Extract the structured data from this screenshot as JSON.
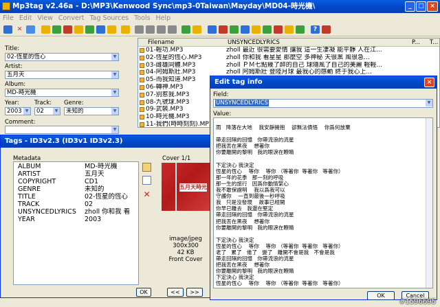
{
  "window": {
    "title": "Mp3tag v2.46a   -   D:\\MP3\\Kenwood Sync\\mp3-0Taiwan\\Mayday\\MD04-時光機\\"
  },
  "menu": [
    "File",
    "Edit",
    "View",
    "Convert",
    "Tag Sources",
    "Tools",
    "Help"
  ],
  "tagpanel": {
    "title_label": "Title:",
    "title_value": "02-恆星的恆心",
    "artist_label": "Artist:",
    "artist_value": "五月天",
    "album_label": "Album:",
    "album_value": "MD-時光機",
    "year_label": "Year:",
    "year_value": "2003",
    "track_label": "Track:",
    "track_value": "02",
    "genre_label": "Genre:",
    "genre_value": "未知的",
    "comment_label": "Comment:"
  },
  "filelist": {
    "col_filename": "Filename",
    "col_lyrics": "UNSYNCEDLYRICS",
    "col_p1": "P...",
    "col_t": "T...",
    "rows": [
      {
        "name": "01-輕功.MP3",
        "lyrics": "zholl  最近 很需要愛情   讓我 這一生凄凝  能平靜  人在江..."
      },
      {
        "name": "02-恆星的恆心.MP3",
        "lyrics": "zholl  你和我   看星星   那麼空    多神秘  天很黑   風很急..."
      },
      {
        "name": "03-雌雄同體.MP3",
        "lyrics": "zholl  ＰＭ七點幾了醉的自己   球隨風了自己的美麗   輕輕..."
      },
      {
        "name": "04-阿姆斯壯.MP3",
        "lyrics": "zholl  阿姆斯壯   登陸月球   最我心的感動   終于我心上..."
      },
      {
        "name": "05-而我知道.MP3",
        "lyrics": ""
      },
      {
        "name": "06-轉神.MP3",
        "lyrics": ""
      },
      {
        "name": "07-別惹我.MP3",
        "lyrics": ""
      },
      {
        "name": "08-九號球.MP3",
        "lyrics": ""
      },
      {
        "name": "09-武裝.MP3",
        "lyrics": ""
      },
      {
        "name": "10-時光機.MP3",
        "lyrics": ""
      },
      {
        "name": "11-我們(時時刻刻).MP3",
        "lyrics": ""
      }
    ]
  },
  "tags_dialog": {
    "title": "Tags - ID3v2.3 (ID3v1 ID3v2.3)",
    "metadata_label": "Metadata",
    "cover_label": "Cover 1/1",
    "rows": [
      {
        "key": "ALBUM",
        "value": "MD-時光機"
      },
      {
        "key": "ARTIST",
        "value": "五月天"
      },
      {
        "key": "COPYRIGHT",
        "value": "CD1"
      },
      {
        "key": "GENRE",
        "value": "未知的"
      },
      {
        "key": "TITLE",
        "value": "02-恆星的恆心"
      },
      {
        "key": "TRACK",
        "value": "02"
      },
      {
        "key": "UNSYNCEDLYRICS",
        "value": "zholl  你和我   看"
      },
      {
        "key": "YEAR",
        "value": "2003"
      }
    ],
    "cover_info": [
      "image/jpeg",
      "300x300",
      "42 KB",
      "Front Cover"
    ],
    "album_art_text": "五月天時光機",
    "ok": "OK",
    "prev": "<<",
    "next": ">>"
  },
  "edit_dialog": {
    "title": "Edit tag info",
    "field_label": "Field:",
    "field_value": "UNSYNCEDLYRICS",
    "value_label": "Value:",
    "lyrics": "\n雨   降落在大地    我安靜擁抱    卻無法債悟    你爲何放棄\n\n帶走回隔的回憶   你帶流浪的流星\n把我丟在黑夜    想著你\n你要離開的黎明   我的眼淚在瞭睛\n\n下定決心 我決定\n恆星的恆心    等你    等你 （等著你  等著你   等著你）\n那一年的花季   那一刻的呼吸\n那一生的旅行   因爲你動情緊心\n我不敢保證明    我以爲我可以\n守護你    一直到最後一秒呼吸\n我   只是沒發現    故事已經開\n你早已離去   我還在堅定\n帶走回隔的回憶   你帶流浪的流星\n把我丟在黑夜    想著你\n你要離開的黎明   我的眼淚在瞭睛\n\n下定決心 我決定\n恆星的恆心    等你    等你 （等著你  等著你   等著你）\n老了   累了   倦了   變了   離開不會是我   不會是我\n帶走回隔的回憶   你帶流浪的流星\n把我丟在黑夜    想著你\n你要離開的黎明   我的眼淚在瞭睛\n下定決心 我決定\n恆星的恆心    等你    等你 （等著你  等著你   等著你）",
    "ok": "OK",
    "cancel": "Cancel"
  },
  "watermark": "#1596695"
}
